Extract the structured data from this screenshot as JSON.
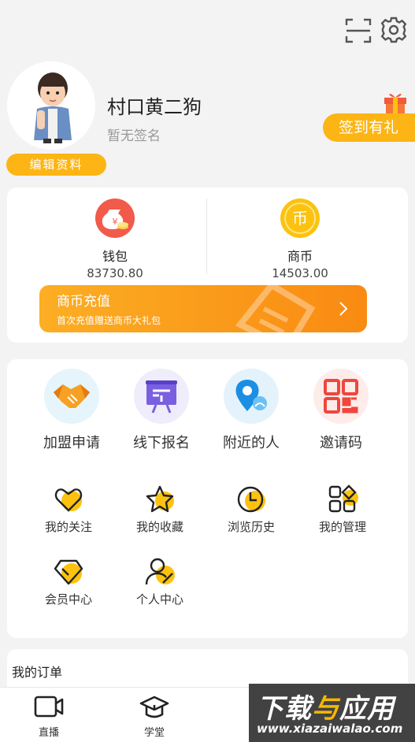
{
  "topbar": {
    "scan_icon": "scan-icon",
    "settings_icon": "gear-icon"
  },
  "profile": {
    "nickname": "村口黄二狗",
    "signature": "暂无签名",
    "edit_label": "编辑资料",
    "checkin_label": "签到有礼"
  },
  "wallet": {
    "label": "钱包",
    "value": "83730.80",
    "icon": "money-bag-icon",
    "color": "#f25a4a"
  },
  "coins": {
    "label": "商币",
    "value": "14503.00",
    "icon_text": "币",
    "color": "#fcc20f"
  },
  "recharge": {
    "title": "商币充值",
    "subtitle": "首次充值赠送商币大礼包"
  },
  "main_menu": [
    {
      "label": "加盟申请",
      "icon": "handshake-icon",
      "bg": "#e6f4fc"
    },
    {
      "label": "线下报名",
      "icon": "signboard-icon",
      "bg": "#efedfb"
    },
    {
      "label": "附近的人",
      "icon": "location-person-icon",
      "bg": "#e4f2fc"
    },
    {
      "label": "邀请码",
      "icon": "qrcode-icon",
      "bg": "#fdecea"
    }
  ],
  "sub_menu": [
    {
      "label": "我的关注",
      "icon": "heart-icon"
    },
    {
      "label": "我的收藏",
      "icon": "star-icon"
    },
    {
      "label": "浏览历史",
      "icon": "clock-icon"
    },
    {
      "label": "我的管理",
      "icon": "grid-icon"
    },
    {
      "label": "会员中心",
      "icon": "diamond-icon"
    },
    {
      "label": "个人中心",
      "icon": "person-icon"
    }
  ],
  "orders": {
    "title": "我的订单"
  },
  "tabbar": [
    {
      "label": "直播",
      "icon": "video-icon"
    },
    {
      "label": "学堂",
      "icon": "graduation-cap-icon"
    }
  ],
  "watermark": {
    "line1_a": "下载",
    "line1_b": "与",
    "line1_c": "应用",
    "line2": "www.xiazaiwalao.com"
  },
  "accent_color": "#fcb514"
}
